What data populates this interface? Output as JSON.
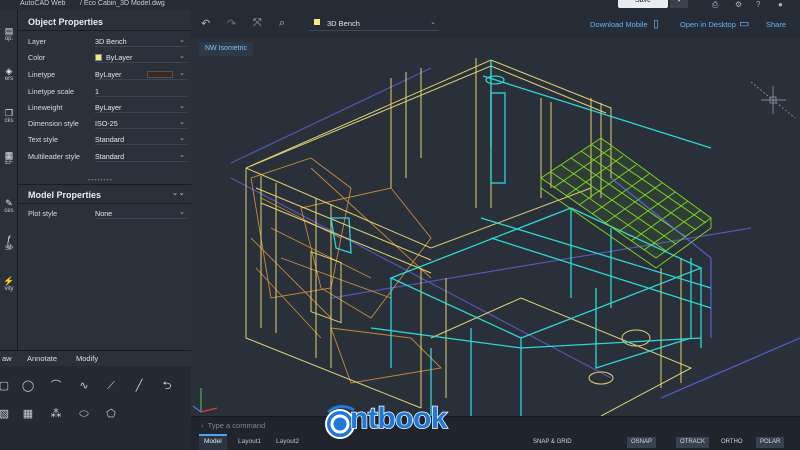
{
  "titlebar": {
    "app_name": "AutoCAD Web",
    "file_name": "/  Eco Cabin_3D Model.dwg",
    "save_label": "Save"
  },
  "toolstrip": {
    "items": [
      {
        "label": "op.",
        "icon": "properties-icon"
      },
      {
        "label": "ers",
        "icon": "layers-icon"
      },
      {
        "label": "cks",
        "icon": "blocks-icon"
      },
      {
        "label": "EF",
        "icon": "xref-icon"
      },
      {
        "label": "ces",
        "icon": "traces-icon"
      },
      {
        "label": "x)",
        "icon": "formula-icon"
      },
      {
        "label": "SP",
        "icon": "lisp-icon"
      },
      {
        "label": "vity",
        "icon": "activity-icon"
      }
    ]
  },
  "object_properties": {
    "title": "Object Properties",
    "rows": [
      {
        "label": "Layer",
        "value": "3D Bench"
      },
      {
        "label": "Color",
        "value": "ByLayer",
        "swatch": "#f3e97e"
      },
      {
        "label": "Linetype",
        "value": "ByLayer",
        "color_bar": "#3b2621"
      },
      {
        "label": "Linetype scale",
        "value": "1"
      },
      {
        "label": "Lineweight",
        "value": "ByLayer"
      },
      {
        "label": "Dimension style",
        "value": "ISO-25"
      },
      {
        "label": "Text style",
        "value": "Standard"
      },
      {
        "label": "Multileader style",
        "value": "Standard"
      }
    ]
  },
  "model_properties": {
    "title": "Model Properties",
    "rows": [
      {
        "label": "Plot style",
        "value": "None"
      }
    ]
  },
  "ribbon": {
    "tabs": [
      "aw",
      "Annotate",
      "Modify"
    ],
    "tools_row1": [
      "rectangle-icon",
      "circle-icon",
      "arc-icon",
      "spline-icon",
      "line-icon",
      "polyline-icon",
      "hatch-boundary-icon"
    ],
    "tools_row2": [
      "hatch-icon",
      "array-icon",
      "point-icon",
      "ellipse-icon",
      "polygon-icon"
    ]
  },
  "canvas_toolbar": {
    "layer": "3D Bench",
    "download_mobile": "Download Mobile",
    "open_desktop": "Open in Desktop",
    "share": "Share"
  },
  "view": {
    "label": "NW Isometric"
  },
  "command_line": {
    "placeholder": "Type a command"
  },
  "status": {
    "tabs": [
      {
        "label": "Model",
        "active": true
      },
      {
        "label": "Layout1",
        "active": false
      },
      {
        "label": "Layout2",
        "active": false
      }
    ],
    "toggles": [
      {
        "label": "SNAP & GRID",
        "on": false
      },
      {
        "label": "OSNAP",
        "on": true
      },
      {
        "label": "OTRACK",
        "on": true
      },
      {
        "label": "ORTHO",
        "on": false
      },
      {
        "label": "POLAR",
        "on": true
      }
    ]
  },
  "watermark": {
    "text": "ntbook"
  },
  "colors": {
    "accent": "#4ea0f0",
    "cyan_wire": "#2fe6e6",
    "yellow_wire": "#f2e27a",
    "green_wire": "#7ddc1f",
    "orange_wire": "#e0a040",
    "ucs_red": "#e53935",
    "ucs_green": "#4caf50"
  }
}
